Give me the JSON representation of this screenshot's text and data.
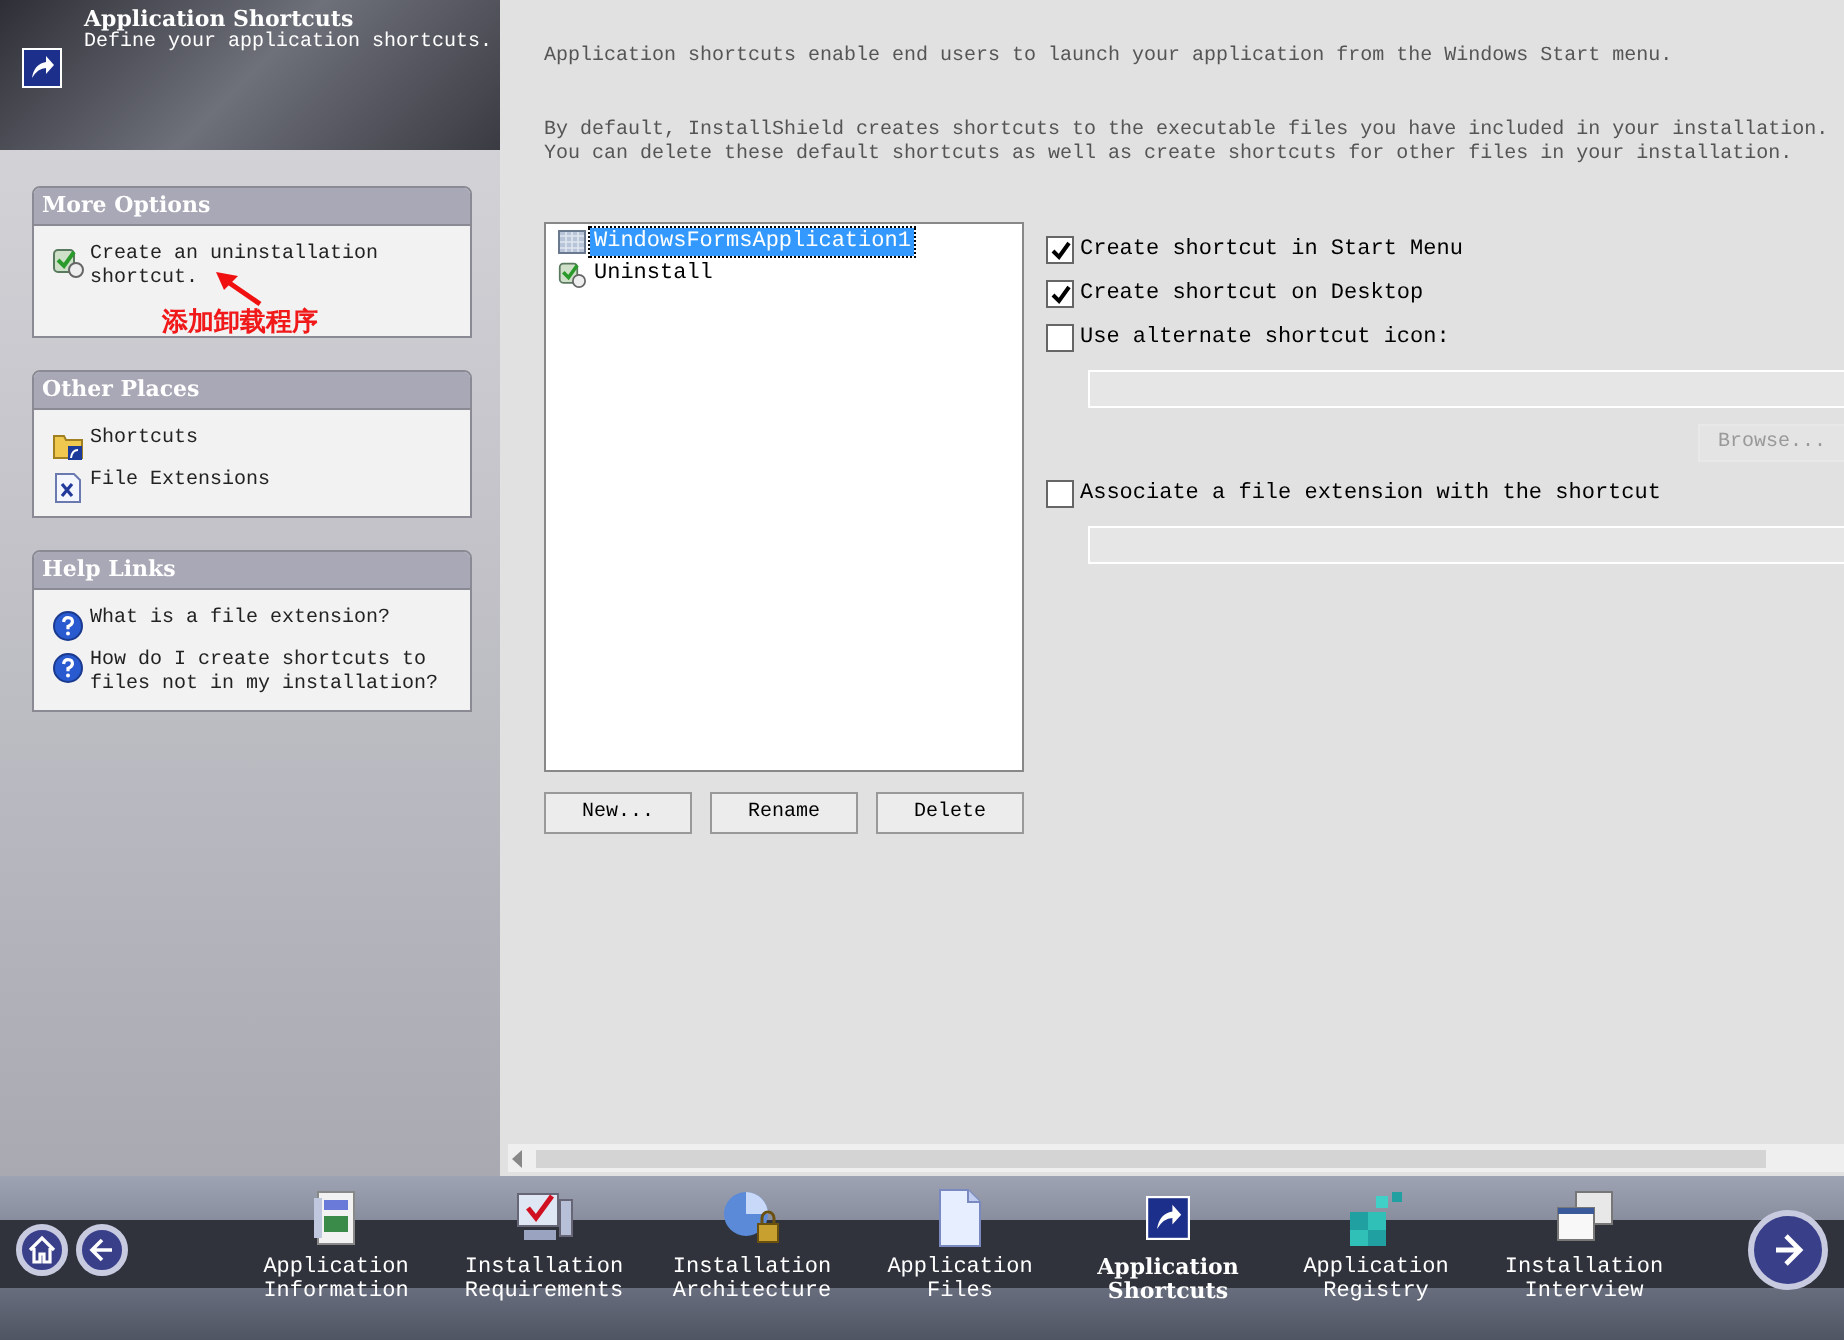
{
  "header": {
    "title": "Application Shortcuts",
    "subtitle": "Define your application shortcuts."
  },
  "sidebar": {
    "panels": [
      {
        "title": "More Options",
        "items": [
          {
            "label": "Create an uninstallation shortcut."
          }
        ]
      },
      {
        "title": "Other Places",
        "items": [
          {
            "label": "Shortcuts"
          },
          {
            "label": "File Extensions"
          }
        ]
      },
      {
        "title": "Help Links",
        "items": [
          {
            "label": "What is a file extension?"
          },
          {
            "label": "How do I create shortcuts to files not in my installation?"
          }
        ]
      }
    ]
  },
  "annotation": "添加卸载程序",
  "intro": [
    "Application shortcuts enable end users to launch your application from the Windows Start menu.",
    "By default, InstallShield creates shortcuts to the executable files you have included in your installation. You can delete these default shortcuts as well as create shortcuts for other files in your installation."
  ],
  "shortcuts": {
    "items": [
      {
        "label": "WindowsFormsApplication1",
        "selected": true
      },
      {
        "label": "Uninstall",
        "selected": false
      }
    ],
    "buttons": [
      "New...",
      "Rename",
      "Delete"
    ]
  },
  "options": [
    {
      "kind": "checkbox",
      "label": "Create shortcut in Start Menu",
      "checked": true
    },
    {
      "kind": "checkbox",
      "label": "Create shortcut on Desktop",
      "checked": true
    },
    {
      "kind": "checkbox",
      "label": "Use alternate shortcut icon:",
      "checked": false
    },
    {
      "kind": "field"
    },
    {
      "kind": "button",
      "label": "Browse...",
      "disabled": true
    },
    {
      "kind": "checkbox",
      "label": "Associate a file extension with the shortcut",
      "checked": false
    },
    {
      "kind": "field"
    }
  ],
  "nav": {
    "items": [
      {
        "label": "Application Information",
        "selected": false
      },
      {
        "label": "Installation Requirements",
        "selected": false
      },
      {
        "label": "Installation Architecture",
        "selected": false
      },
      {
        "label": "Application Files",
        "selected": false
      },
      {
        "label": "Application Shortcuts",
        "selected": true
      },
      {
        "label": "Application Registry",
        "selected": false
      },
      {
        "label": "Installation Interview",
        "selected": false
      }
    ]
  }
}
